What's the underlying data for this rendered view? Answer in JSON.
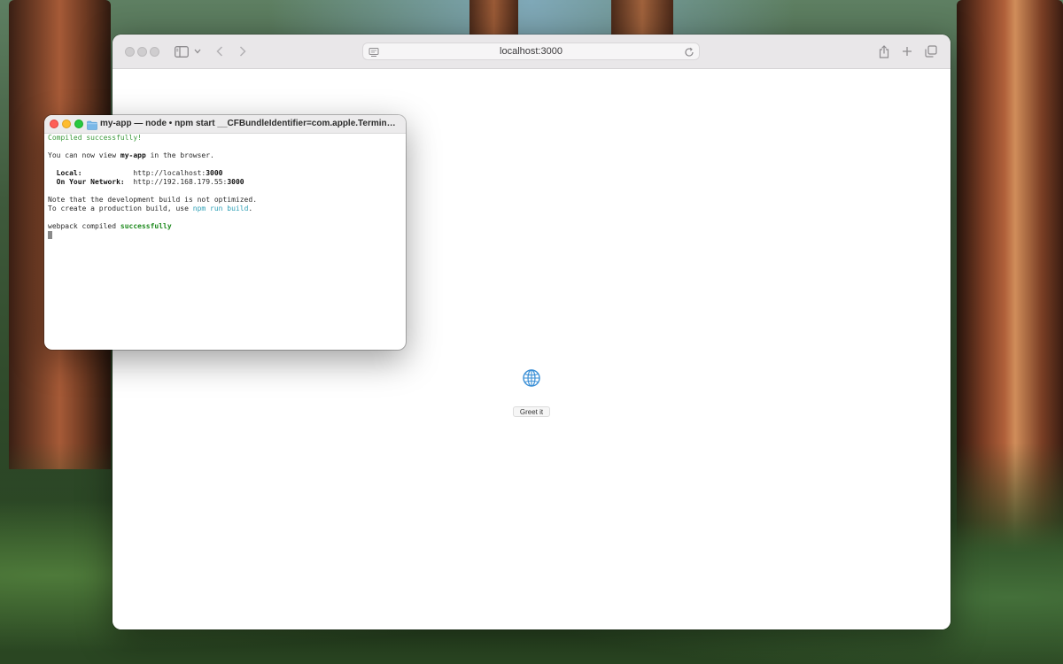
{
  "browser": {
    "address": "localhost:3000",
    "page": {
      "button_label": "Greet it"
    }
  },
  "terminal": {
    "title": "my-app — node • npm start __CFBundleIdentifier=com.apple.Terminal T...",
    "lines": {
      "compiled": "Compiled successfully!",
      "view_prefix": "You can now view ",
      "view_app": "my-app",
      "view_suffix": " in the browser.",
      "local_label": "Local:",
      "local_url_prefix": "http://localhost:",
      "local_port": "3000",
      "network_label": "On Your Network:",
      "network_url_prefix": "http://192.168.179.55:",
      "network_port": "3000",
      "note": "Note that the development build is not optimized.",
      "create_prefix": "To create a production build, use ",
      "create_cmd": "npm run build",
      "create_suffix": ".",
      "webpack_prefix": "webpack compiled ",
      "webpack_status": "successfully"
    }
  },
  "colors": {
    "terminal_green": "#3c9a3c",
    "terminal_cyan": "#2d9fb5",
    "close": "#fe5f57",
    "minimize": "#febc2e",
    "maximize": "#28c840"
  }
}
